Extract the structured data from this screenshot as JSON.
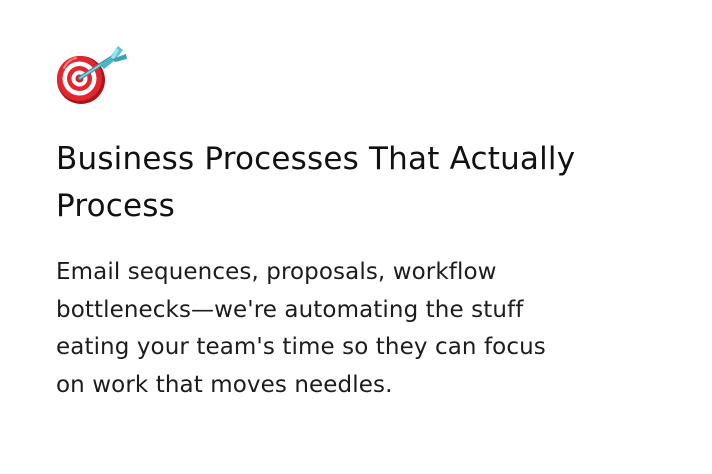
{
  "card": {
    "icon": "bullseye-dart-icon",
    "title_line1": "Business Processes That Actually",
    "title_line2": "Process",
    "desc_lines": [
      "Email sequences, proposals, workflow",
      "bottlenecks—we're automating the stuff",
      "eating your team's time so they can focus",
      "on work that moves needles."
    ]
  },
  "colors": {
    "background": "#ffffff",
    "title": "#111111",
    "body": "#1c1c1c",
    "target_red": "#d9242b",
    "dart_teal": "#4fb3c6"
  }
}
